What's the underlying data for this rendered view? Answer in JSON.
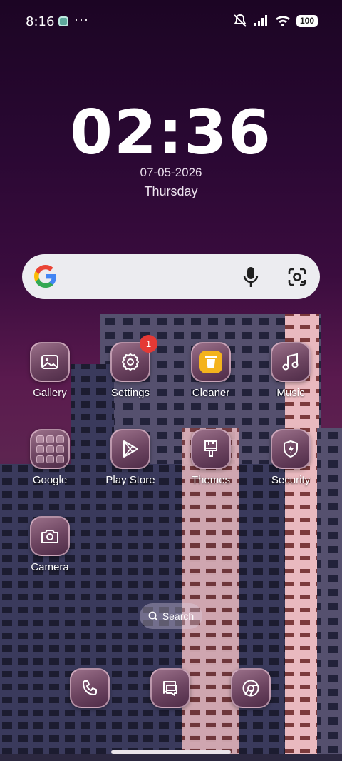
{
  "status_bar": {
    "time": "8:16",
    "overflow": "···",
    "battery": "100",
    "icons": [
      "app-notification-icon",
      "mute-icon",
      "signal-icon",
      "wifi-icon",
      "battery-icon"
    ]
  },
  "clock": {
    "time": "02:36",
    "date": "07-05-2026",
    "weekday": "Thursday"
  },
  "search_widget": {
    "icons": [
      "google-logo-icon",
      "mic-icon",
      "google-lens-icon"
    ]
  },
  "apps": [
    {
      "label": "Gallery",
      "icon": "gallery-icon"
    },
    {
      "label": "Settings",
      "icon": "gear-icon",
      "badge": "1"
    },
    {
      "label": "Cleaner",
      "icon": "trash-icon"
    },
    {
      "label": "Music",
      "icon": "music-icon"
    },
    {
      "label": "Google",
      "icon": "folder-icon"
    },
    {
      "label": "Play Store",
      "icon": "play-store-icon"
    },
    {
      "label": "Themes",
      "icon": "brush-icon"
    },
    {
      "label": "Security",
      "icon": "shield-icon"
    },
    {
      "label": "Camera",
      "icon": "camera-icon"
    }
  ],
  "page_search": {
    "label": "Search",
    "icon": "search-icon"
  },
  "dock": [
    {
      "icon": "phone-icon"
    },
    {
      "icon": "messages-icon"
    },
    {
      "icon": "chrome-icon"
    }
  ],
  "colors": {
    "badge": "#e53935",
    "cleaner": "#f4b31d",
    "tile_border": "#f0c8dc"
  }
}
